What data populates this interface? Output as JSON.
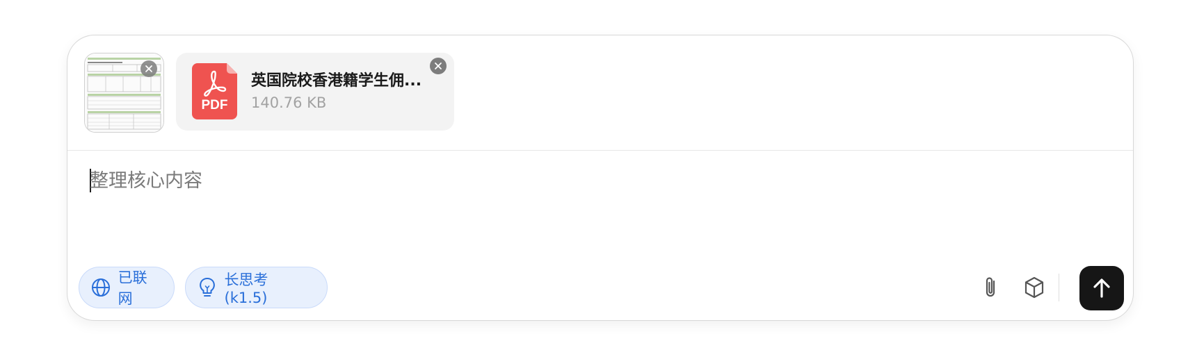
{
  "attachments": {
    "image_thumbnail": {
      "icon": "document-preview-thumbnail"
    },
    "file": {
      "name": "英国院校香港籍学生佣...",
      "size": "140.76 KB",
      "type_label": "PDF",
      "icon": "pdf-file-icon",
      "icon_color": "#ef5350"
    }
  },
  "input": {
    "placeholder": "整理核心内容",
    "value": ""
  },
  "toggles": [
    {
      "label": "已联网",
      "icon": "globe-icon",
      "active": true
    },
    {
      "label": "长思考 (k1.5)",
      "icon": "lightbulb-icon",
      "active": true
    }
  ],
  "toolbar": {
    "attach_icon": "paperclip-icon",
    "model_icon": "cube-icon",
    "send_icon": "arrow-up-icon"
  },
  "colors": {
    "accent": "#2a6fd9",
    "pill_bg": "#e8f0fd",
    "send_bg": "#161616"
  }
}
